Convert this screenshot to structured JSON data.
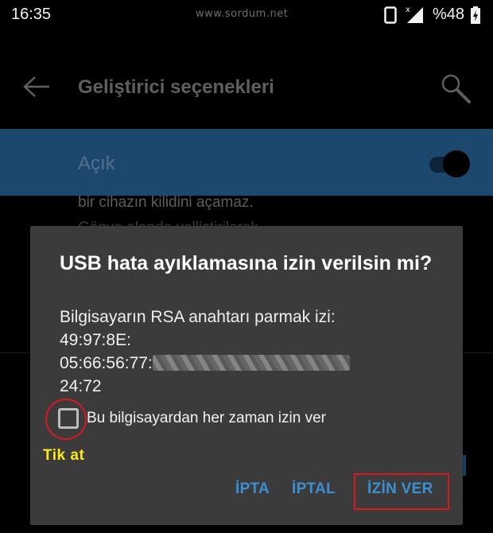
{
  "status_bar": {
    "time": "16:35",
    "watermark": "www.sordum.net",
    "battery_percent": "%48",
    "icons": [
      "phone-icon",
      "signal-icon",
      "battery-icon"
    ]
  },
  "toolbar": {
    "title": "Geliştirici seçenekleri",
    "back_icon": "arrow-back-icon",
    "search_icon": "search-icon"
  },
  "master_switch": {
    "label": "Açık",
    "state": "on",
    "color": "#1c486e"
  },
  "background": {
    "text_line1": "bir cihazın kilidini açamaz.",
    "text_line2": "Gönye alanda yelliştirilerek"
  },
  "dialog": {
    "title": "USB hata ayıklamasına izin verilsin mi?",
    "body_line1": "Bilgisayarın RSA anahtarı parmak izi:",
    "body_line2": "49:97:8E:",
    "body_line3": "05:66:56:77:",
    "body_line4": "24:72",
    "checkbox_label": "Bu bilgisayardan her zaman izin ver",
    "checkbox_checked": false,
    "annotation": "Tik at",
    "buttons": {
      "ipta": "İPTA",
      "iptal": "İPTAL",
      "allow": "İZİN VER"
    },
    "colors": {
      "button": "#3d8fd3",
      "highlight": "#d71920",
      "annotation": "#ffe81a"
    }
  }
}
